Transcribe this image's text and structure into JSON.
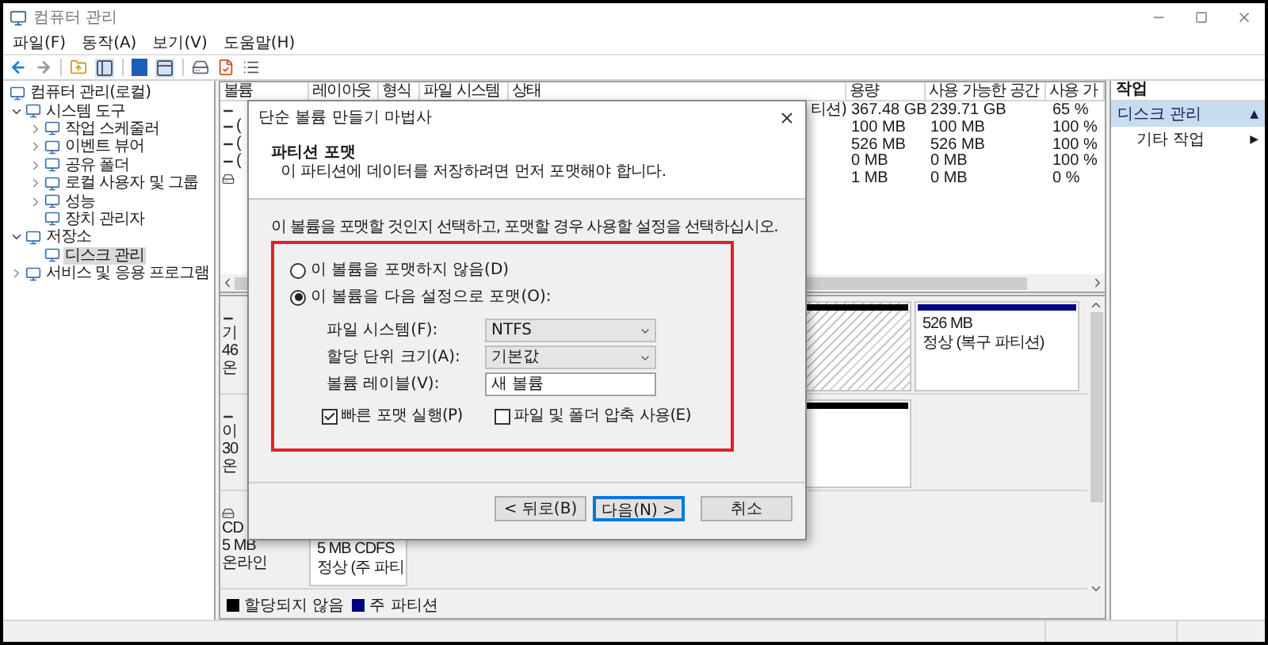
{
  "window": {
    "title": "컴퓨터 관리"
  },
  "menu": [
    "파일(F)",
    "동작(A)",
    "보기(V)",
    "도움말(H)"
  ],
  "tree": [
    {
      "label": "컴퓨터 관리(로컬)",
      "kind": "root",
      "selected": false,
      "children": [
        {
          "label": "시스템 도구",
          "kind": "node",
          "expanded": true,
          "selected": false,
          "children": [
            {
              "label": "작업 스케줄러",
              "kind": "node",
              "expanded": false,
              "selected": false
            },
            {
              "label": "이벤트 뷰어",
              "kind": "node",
              "expanded": false,
              "selected": false
            },
            {
              "label": "공유 폴더",
              "kind": "node",
              "expanded": false,
              "selected": false
            },
            {
              "label": "로컬 사용자 및 그룹",
              "kind": "node",
              "expanded": false,
              "selected": false
            },
            {
              "label": "성능",
              "kind": "node",
              "expanded": false,
              "selected": false
            },
            {
              "label": "장치 관리자",
              "kind": "leaf",
              "selected": false
            }
          ]
        },
        {
          "label": "저장소",
          "kind": "node",
          "expanded": true,
          "selected": false,
          "children": [
            {
              "label": "디스크 관리",
              "kind": "leaf",
              "selected": true
            }
          ]
        },
        {
          "label": "서비스 및 응용 프로그램",
          "kind": "node",
          "expanded": false,
          "selected": false
        }
      ]
    }
  ],
  "volumes": {
    "columns": [
      "볼륨",
      "레이아웃",
      "형식",
      "파일 시스템",
      "상태",
      "용량",
      "사용 가능한 공간",
      "사용 가"
    ],
    "rows": [
      {
        "kind": "disk",
        "status": "티션)",
        "capacity": "367.48 GB",
        "free": "239.71 GB",
        "percent": "65 %"
      },
      {
        "kind": "disk",
        "volume": "(",
        "capacity": "100 MB",
        "free": "100 MB",
        "percent": "100 %"
      },
      {
        "kind": "disk",
        "volume": "(",
        "capacity": "526 MB",
        "free": "526 MB",
        "percent": "100 %"
      },
      {
        "kind": "disk",
        "volume": "(",
        "capacity": "0 MB",
        "free": "0 MB",
        "percent": "100 %"
      },
      {
        "kind": "cd",
        "capacity": "1 MB",
        "free": "0 MB",
        "percent": "0 %"
      }
    ]
  },
  "disks": [
    {
      "kind": "disk",
      "lines": [
        "기",
        "46",
        "온"
      ],
      "partitions": [
        {
          "kind": "unallocated",
          "selected": true
        },
        {
          "kind": "primary",
          "selected": false,
          "lines": [
            "526 MB",
            "정상 (복구 파티션)"
          ]
        }
      ]
    },
    {
      "kind": "disk",
      "lines": [
        "이",
        "30",
        "온"
      ],
      "partitions": [
        {
          "kind": "unallocated",
          "selected": false
        }
      ]
    },
    {
      "kind": "cd",
      "lines": [
        "CD",
        "5 MB",
        "온라인"
      ],
      "partitions": [
        {
          "kind": "cdpart",
          "selected": false,
          "lines": [
            "5 MB CDFS",
            "정상 (주 파티"
          ]
        }
      ]
    }
  ],
  "legend": [
    {
      "label": "할당되지 않음",
      "color": "#000000"
    },
    {
      "label": "주 파티션",
      "color": "#000080"
    }
  ],
  "actions": {
    "title": "작업",
    "items": [
      {
        "label": "디스크 관리",
        "arrow": "▲",
        "selected": true
      },
      {
        "label": "기타 작업",
        "arrow": "▶",
        "selected": false
      }
    ]
  },
  "dialog": {
    "title": "단순 볼륨 만들기 마법사",
    "heading": "파티션 포맷",
    "subheading": "이 파티션에 데이터를 저장하려면 먼저 포맷해야 합니다.",
    "instruction": "이 볼륨을 포맷할 것인지 선택하고, 포맷할 경우 사용할 설정을 선택하십시오.",
    "options": [
      {
        "label": "이 볼륨을 포맷하지 않음(D)",
        "selected": false
      },
      {
        "label": "이 볼륨을 다음 설정으로 포맷(O):",
        "selected": true
      }
    ],
    "fields": [
      {
        "kind": "select",
        "label": "파일 시스템(F):",
        "value": "NTFS"
      },
      {
        "kind": "select",
        "label": "할당 단위 크기(A):",
        "value": "기본값"
      },
      {
        "kind": "text",
        "label": "볼륨 레이블(V):",
        "value": "새 볼륨"
      }
    ],
    "checkboxes": [
      {
        "label": "빠른 포맷 실행(P)",
        "checked": true
      },
      {
        "label": "파일 및 폴더 압축 사용(E)",
        "checked": false
      }
    ],
    "buttons": [
      {
        "label": "< 뒤로(B)",
        "default": false
      },
      {
        "label": "다음(N) >",
        "default": true
      },
      {
        "label": "취소",
        "default": false
      }
    ]
  }
}
